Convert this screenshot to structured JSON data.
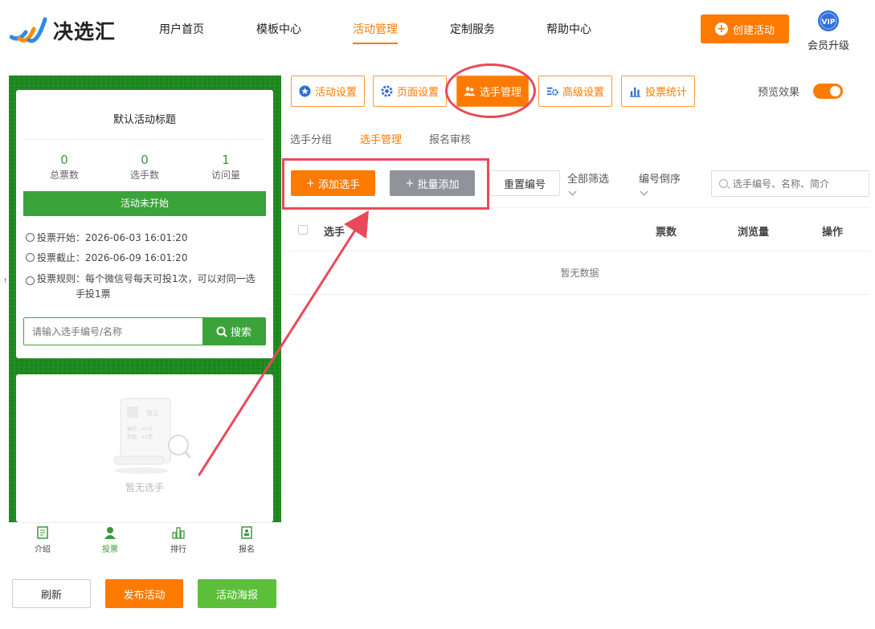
{
  "logo": {
    "text": "决选汇"
  },
  "nav": {
    "items": [
      "用户首页",
      "模板中心",
      "活动管理",
      "定制服务",
      "帮助中心"
    ],
    "active": "活动管理",
    "create_label": "创建活动",
    "vip_badge": "VIP",
    "vip_label": "会员升级"
  },
  "preview": {
    "title": "默认活动标题",
    "stats": [
      {
        "value": "0",
        "label": "总票数"
      },
      {
        "value": "0",
        "label": "选手数"
      },
      {
        "value": "1",
        "label": "访问量"
      }
    ],
    "status": "活动未开始",
    "vote_start": "投票开始：2026-06-03 16:01:20",
    "vote_end": "投票截止：2026-06-09 16:01:20",
    "vote_rule": "投票规则：每个微信号每天可投1次，可以对同一选手投1票",
    "search_placeholder": "请输入选手编号/名称",
    "search_label": "搜索",
    "empty_card": {
      "name": "张三",
      "line1": "编号：XX号",
      "line2": "票数：XX票"
    },
    "empty_text": "暂无选手",
    "tabbar": [
      {
        "label": "介绍",
        "icon": "intro-icon"
      },
      {
        "label": "投票",
        "icon": "vote-icon"
      },
      {
        "label": "排行",
        "icon": "rank-icon"
      },
      {
        "label": "报名",
        "icon": "signup-icon"
      }
    ],
    "tabbar_active": "投票"
  },
  "bottom_buttons": {
    "refresh": "刷新",
    "publish": "发布活动",
    "poster": "活动海报"
  },
  "settings_tabs": [
    {
      "label": "活动设置",
      "icon": "star-icon"
    },
    {
      "label": "页面设置",
      "icon": "gear-icon"
    },
    {
      "label": "选手管理",
      "icon": "users-icon"
    },
    {
      "label": "高级设置",
      "icon": "advanced-icon"
    },
    {
      "label": "投票统计",
      "icon": "bar-chart-icon"
    }
  ],
  "settings_active": "选手管理",
  "preview_toggle": {
    "label": "预览效果",
    "on": true
  },
  "sub_tabs": [
    "选手分组",
    "选手管理",
    "报名审核"
  ],
  "sub_active": "选手管理",
  "toolbar": {
    "add": "添加选手",
    "batch_add": "批量添加",
    "renumber": "重置编号",
    "filter": "全部筛选",
    "sort": "编号倒序",
    "search_placeholder": "选手编号、名称、简介"
  },
  "table": {
    "columns": [
      "选手",
      "票数",
      "浏览量",
      "操作"
    ],
    "empty": "暂无数据"
  },
  "colors": {
    "accent": "#ff7a00",
    "green": "#3aa33a",
    "annotation": "#e84a5a"
  }
}
